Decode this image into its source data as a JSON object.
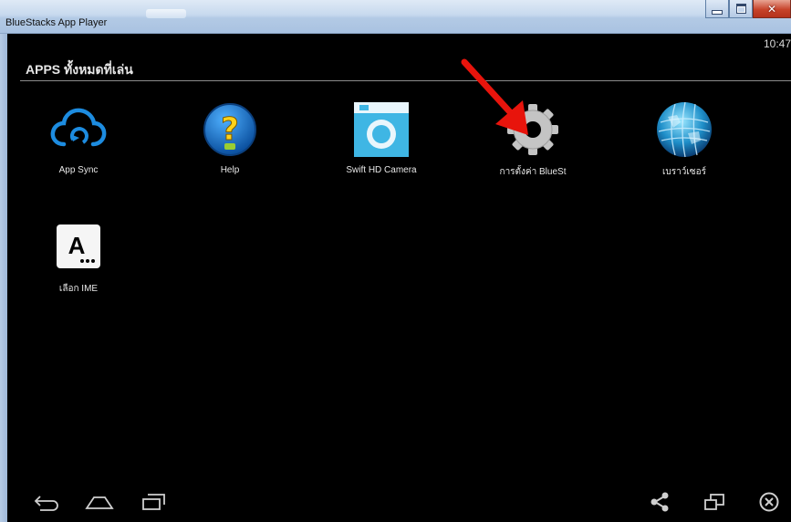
{
  "window": {
    "title": "BlueStacks App Player"
  },
  "status": {
    "time": "10:47"
  },
  "section": {
    "title": "APPS ทั้งหมดที่เล่น"
  },
  "apps": [
    {
      "label": "App Sync",
      "icon": "cloud-sync-icon"
    },
    {
      "label": "Help",
      "icon": "help-question-icon"
    },
    {
      "label": "Swift HD Camera",
      "icon": "camera-icon"
    },
    {
      "label": "การตั้งค่า BlueSt",
      "icon": "settings-gear-icon"
    },
    {
      "label": "เบราว์เซอร์",
      "icon": "globe-browser-icon"
    },
    {
      "label": "เลือก IME",
      "icon": "keyboard-ime-icon"
    }
  ],
  "navigation": [
    "back-icon",
    "home-icon",
    "recent-apps-icon",
    "share-icon",
    "window-resize-icon",
    "close-circle-icon"
  ],
  "colors": {
    "accent_blue": "#1d8ce0",
    "annotation_arrow": "#e8140c",
    "gear_gray": "#bdbdbd"
  }
}
